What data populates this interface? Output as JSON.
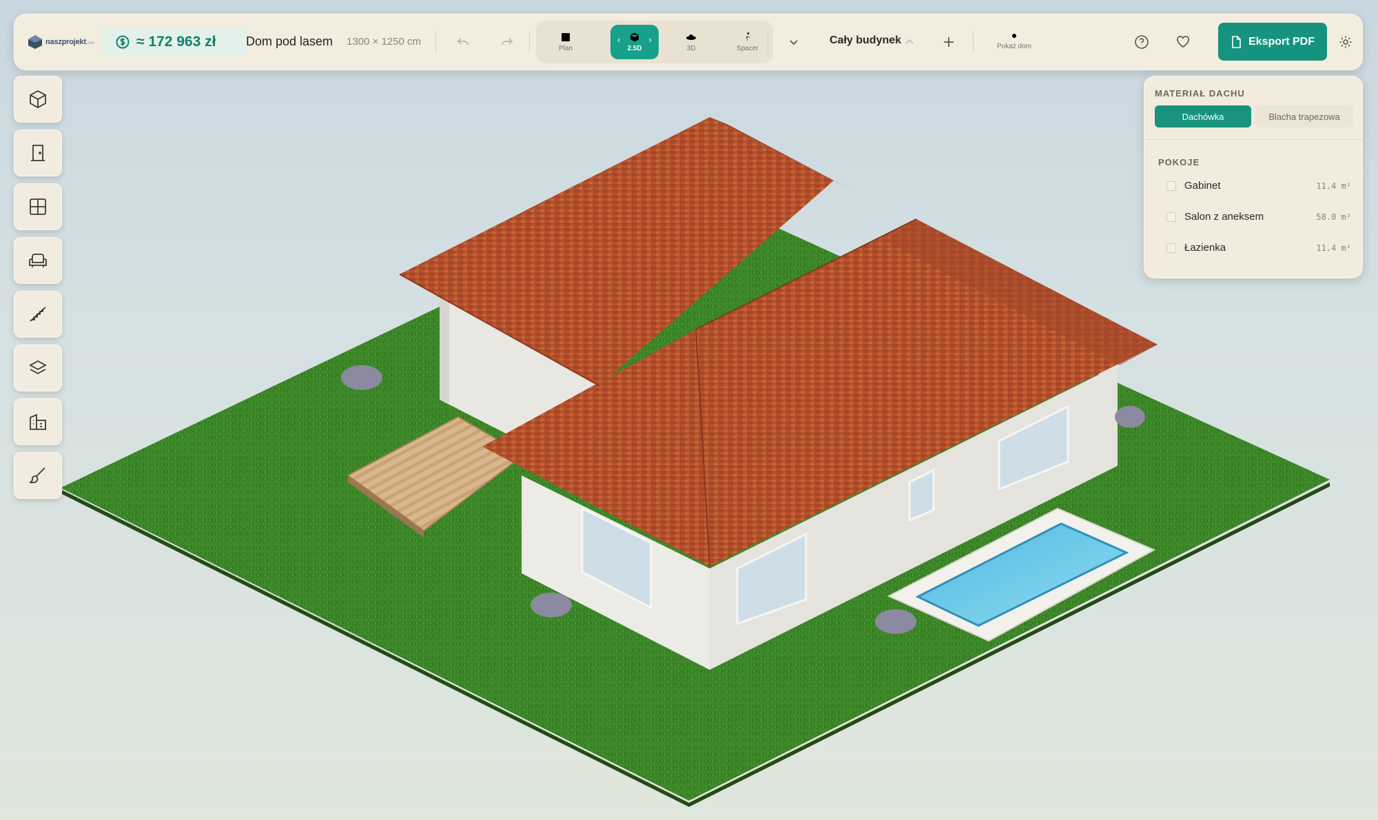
{
  "app": {
    "logo_text": "naszprojekt",
    "logo_sub": ".com"
  },
  "header": {
    "price": "≈ 172 963 zł",
    "project_name": "Dom pod lasem",
    "dimensions": "1300 × 1250 cm",
    "views": [
      {
        "label": "Plan",
        "active": false
      },
      {
        "label": "2.5D",
        "active": true
      },
      {
        "label": "3D",
        "active": false
      },
      {
        "label": "Spacer",
        "active": false
      }
    ],
    "level": "Cały budynek",
    "show_house_label": "Pokaż dom",
    "export_label": "Eksport PDF"
  },
  "tools": [
    "cube-icon",
    "door-icon",
    "window-icon",
    "armchair-icon",
    "stairs-icon",
    "layers-icon",
    "building-icon",
    "brush-icon"
  ],
  "panel": {
    "roof_title": "MATERIAŁ DACHU",
    "roof_options": [
      {
        "label": "Dachówka",
        "selected": true
      },
      {
        "label": "Blacha trapezowa",
        "selected": false
      }
    ],
    "rooms_title": "POKOJE",
    "rooms": [
      {
        "name": "Gabinet",
        "area": "11.4 m²",
        "checked": false
      },
      {
        "name": "Salon z aneksem",
        "area": "58.0 m²",
        "checked": false
      },
      {
        "name": "Łazienka",
        "area": "11.4 m²",
        "checked": false
      }
    ]
  },
  "colors": {
    "accent": "#16937e",
    "roof": "#b9542c",
    "grass": "#3f8a2a",
    "wall": "#ecebe6",
    "pool": "#5bc4e4"
  }
}
